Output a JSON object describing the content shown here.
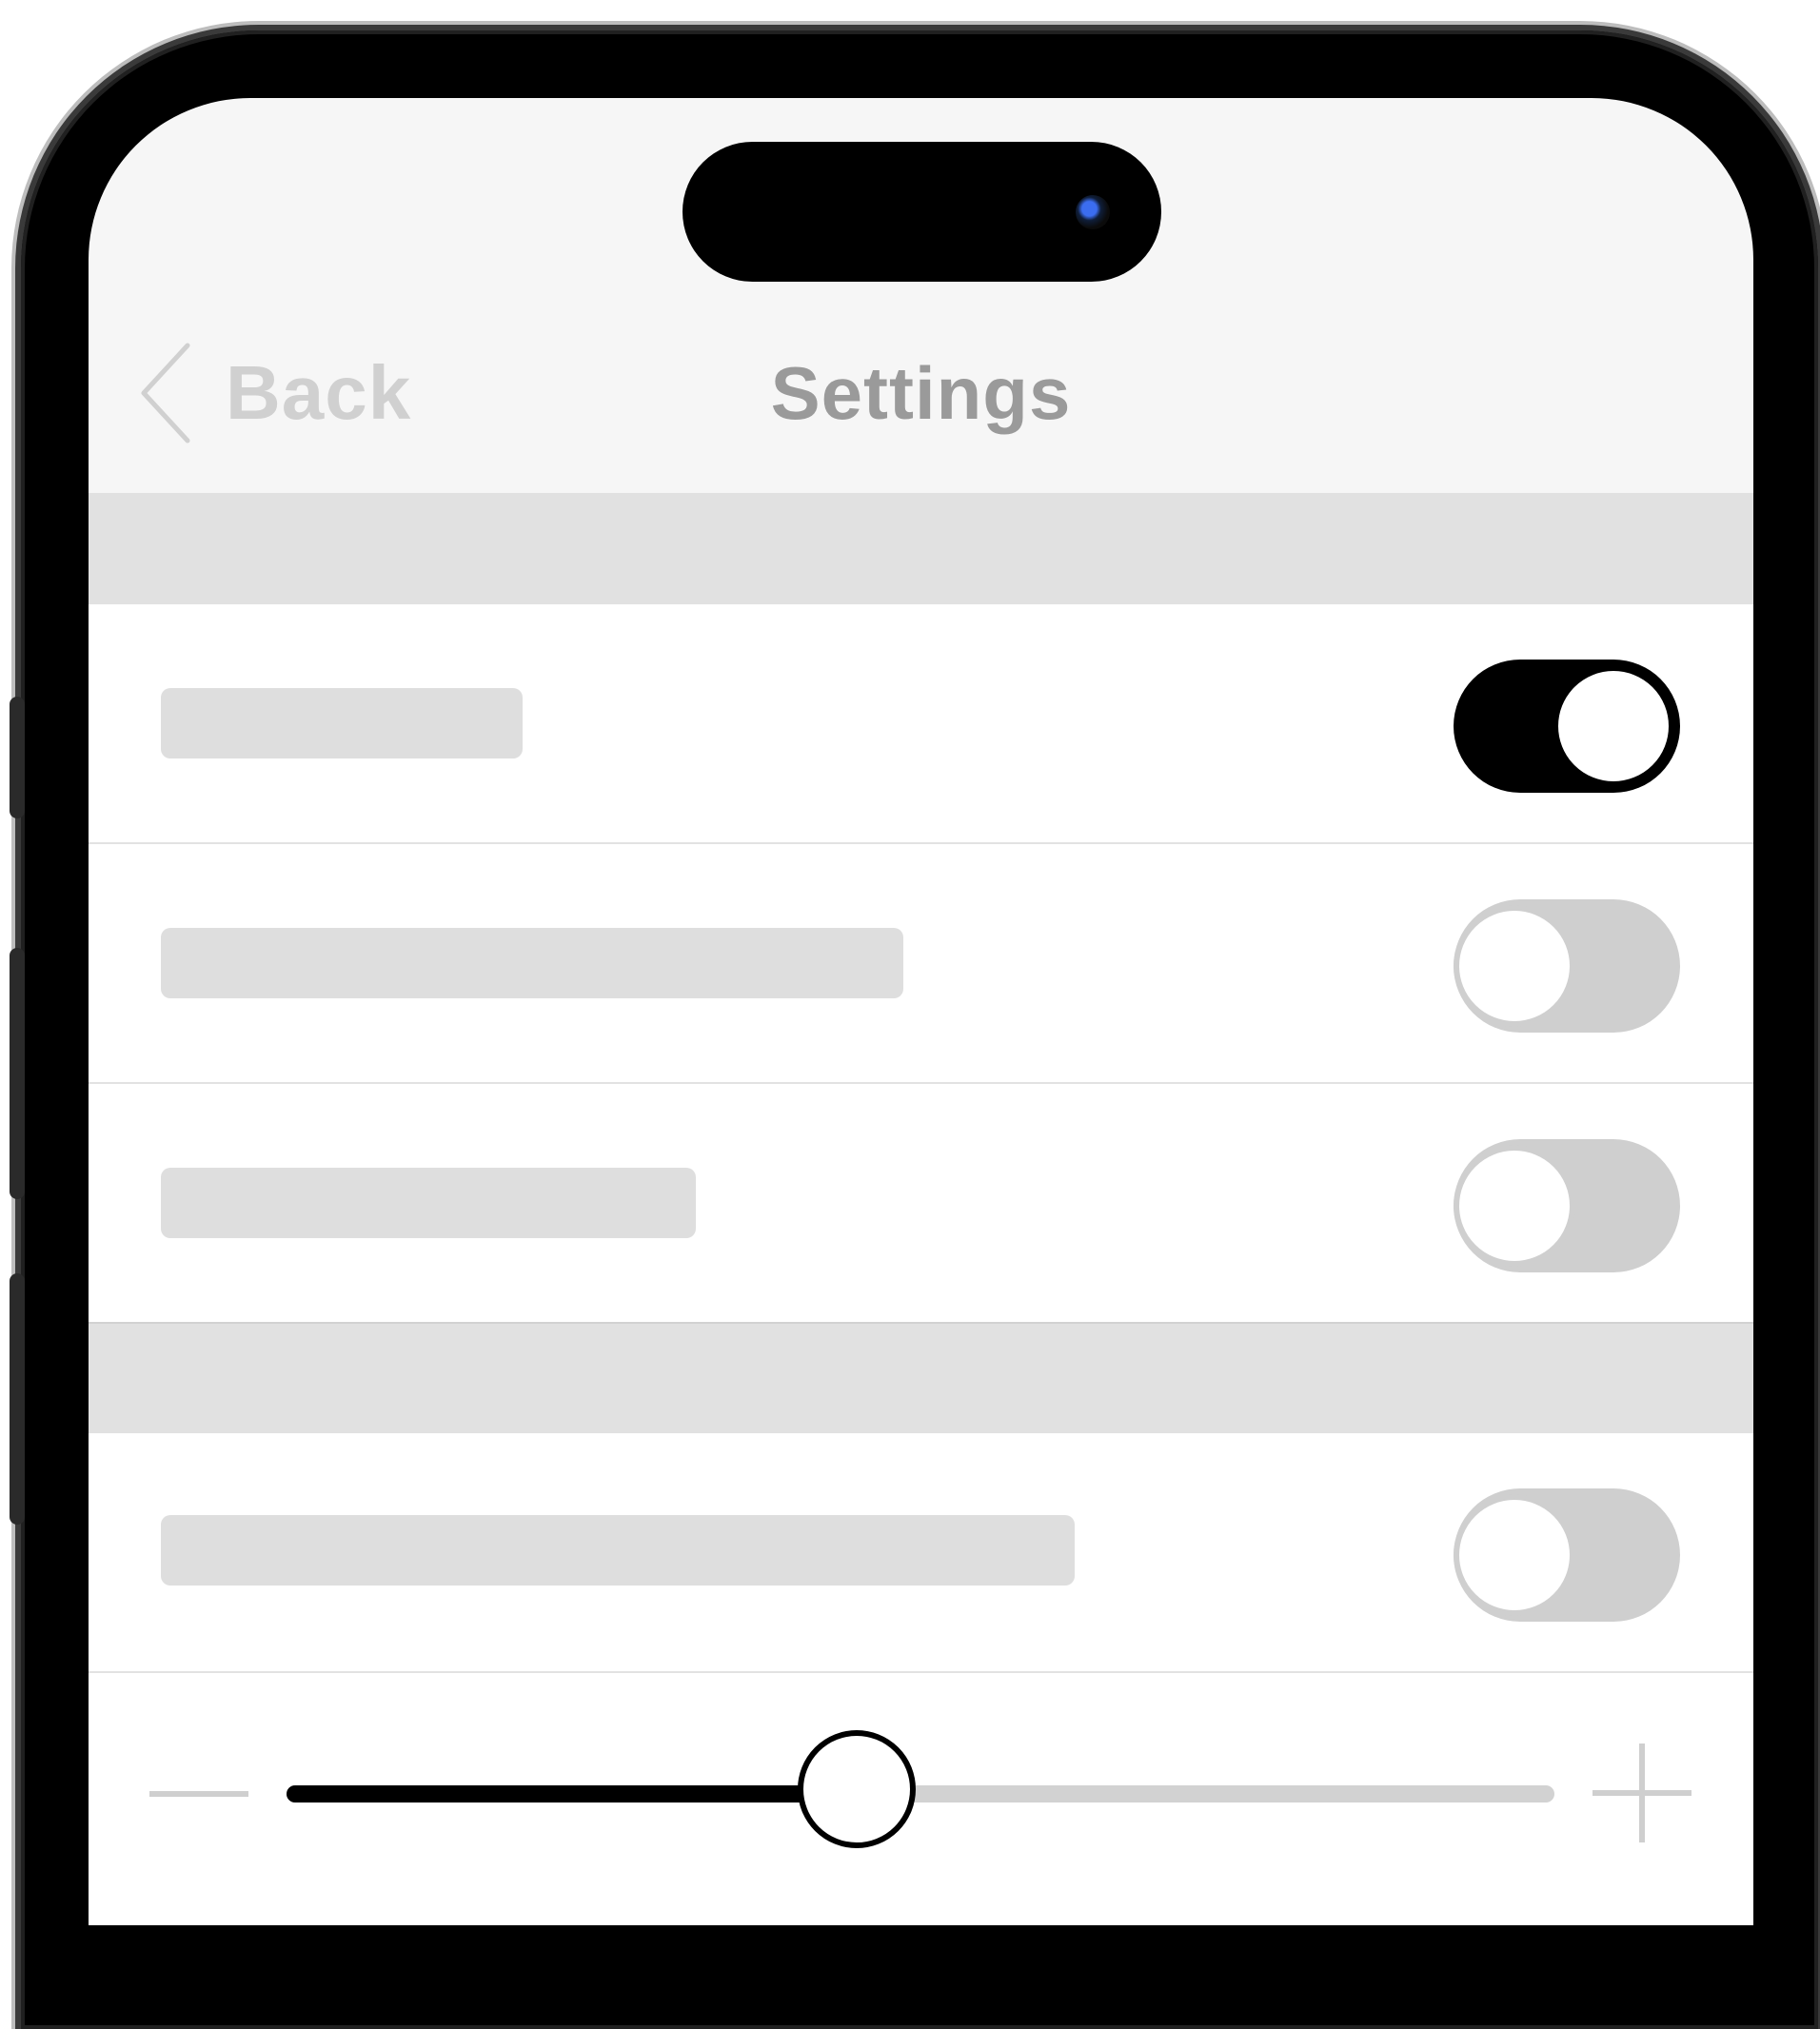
{
  "nav": {
    "back_label": "Back",
    "title": "Settings",
    "back_icon": "chevron-left-icon"
  },
  "settings": {
    "group1": [
      {
        "label": "",
        "toggle_on": true
      },
      {
        "label": "",
        "toggle_on": false
      },
      {
        "label": "",
        "toggle_on": false
      }
    ],
    "group2": [
      {
        "label": "",
        "toggle_on": false
      }
    ],
    "slider": {
      "value": 0.45,
      "min_icon": "minus-icon",
      "max_icon": "plus-icon"
    }
  },
  "colors": {
    "accent": "#000000",
    "inactive": "#cfcfcf",
    "section_header": "#e1e1e1",
    "placeholder": "#dedede"
  }
}
